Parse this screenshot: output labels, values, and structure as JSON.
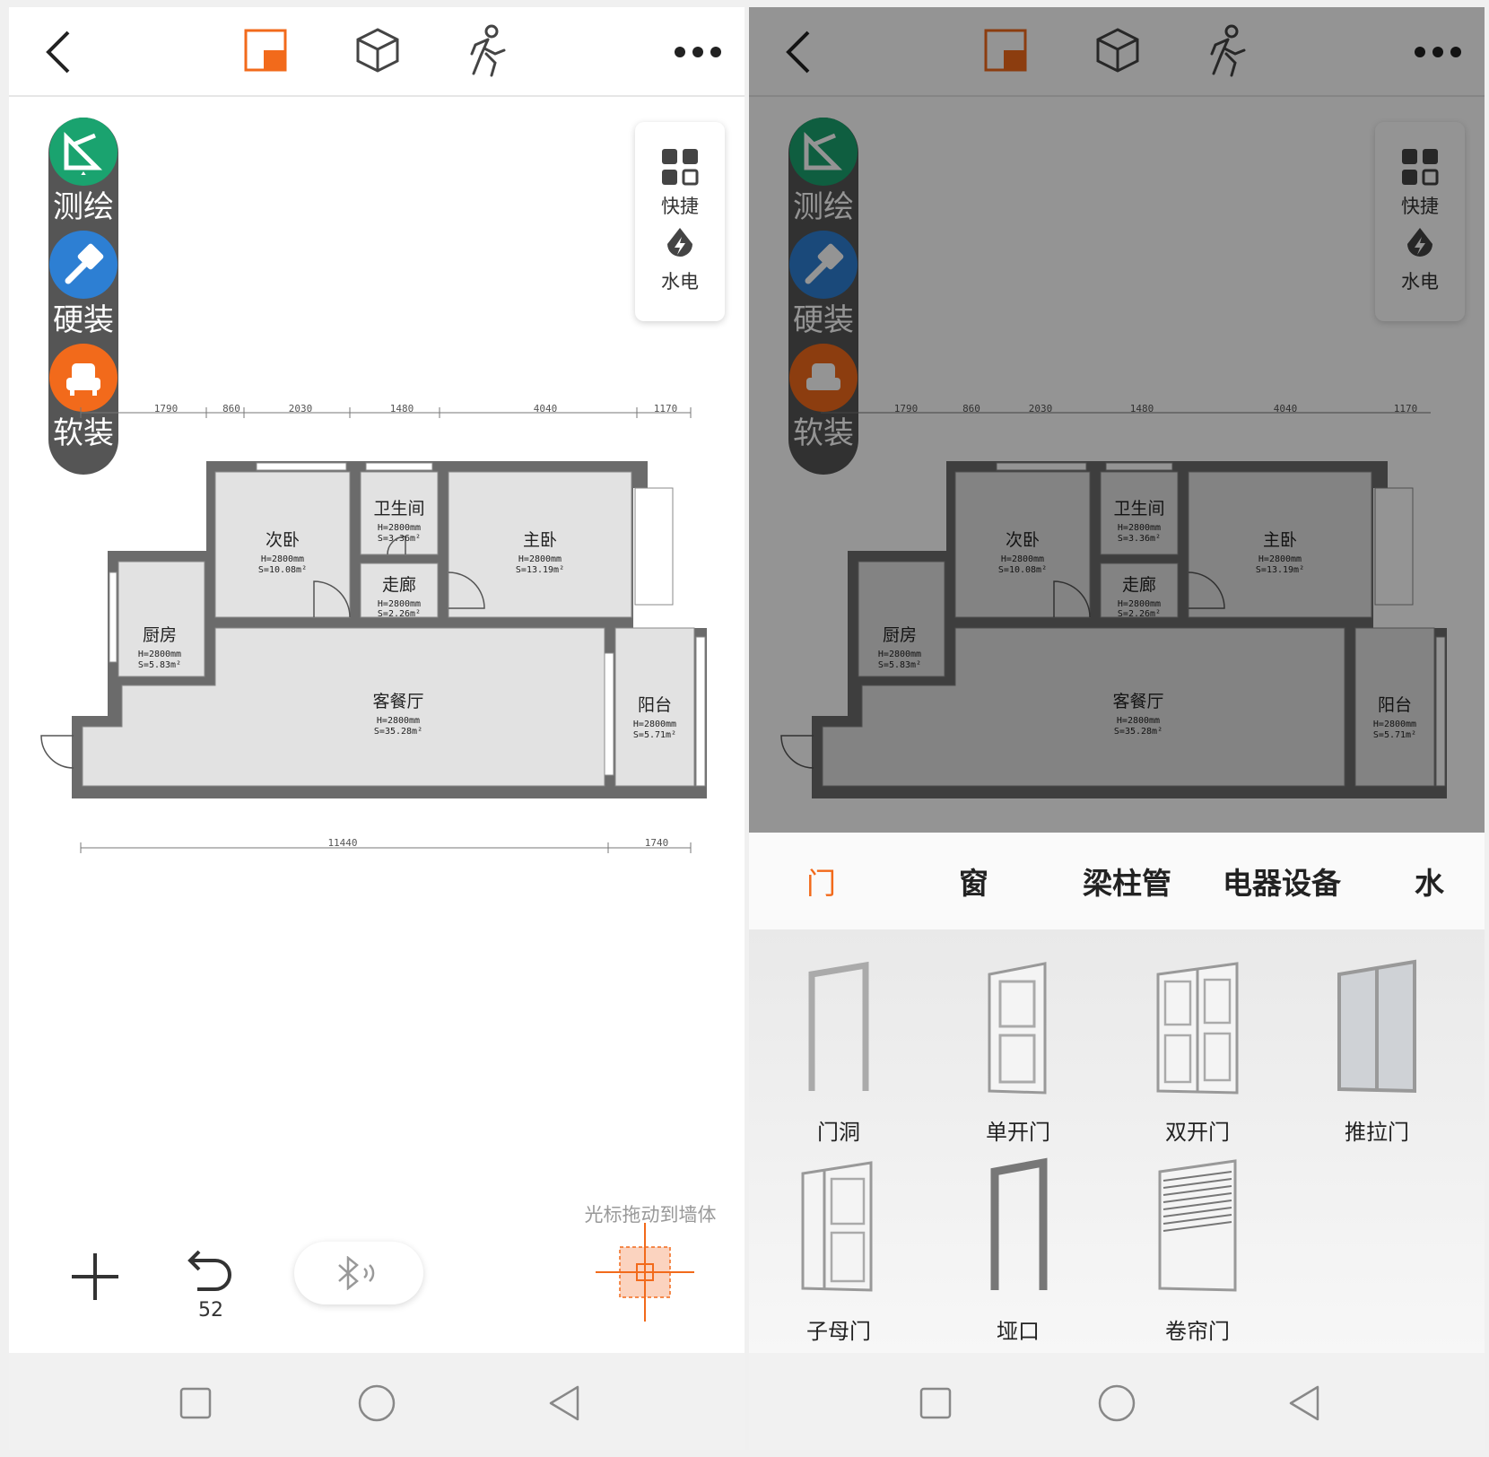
{
  "colors": {
    "accent": "#f26a1b",
    "survey": "#1aa36f",
    "hard": "#2d7fd3",
    "soft": "#f26a1b",
    "dark_bar": "#555555"
  },
  "left_screen": {
    "toolbar": {
      "back_icon": "chevron-left-icon",
      "plan_icon": "floor-plan-icon",
      "cube_icon": "3d-cube-icon",
      "walk_icon": "walk-icon",
      "more_icon": "more-icon"
    },
    "side_tools": [
      {
        "label": "测绘",
        "icon": "ruler-icon"
      },
      {
        "label": "硬装",
        "icon": "brush-icon"
      },
      {
        "label": "软装",
        "icon": "sofa-icon"
      }
    ],
    "quick_panel": {
      "shortcut_label": "快捷",
      "water_elec_label": "水电"
    },
    "floorplan": {
      "top_dims": [
        "1790",
        "860",
        "2030",
        "1480",
        "4040",
        "1170"
      ],
      "bottom_dims": [
        "11440",
        "1740"
      ],
      "rooms": [
        {
          "name": "次卧",
          "height": "H=2800mm",
          "area": "S=10.08m²"
        },
        {
          "name": "卫生间",
          "height": "H=2800mm",
          "area": "S=3.36m²"
        },
        {
          "name": "主卧",
          "height": "H=2800mm",
          "area": "S=13.19m²"
        },
        {
          "name": "走廊",
          "height": "H=2800mm",
          "area": "S=2.26m²"
        },
        {
          "name": "厨房",
          "height": "H=2800mm",
          "area": "S=5.83m²"
        },
        {
          "name": "客餐厅",
          "height": "H=2800mm",
          "area": "S=35.28m²"
        },
        {
          "name": "阳台",
          "height": "H=2800mm",
          "area": "S=5.71m²"
        }
      ]
    },
    "hint": "光标拖动到墙体",
    "undo_count": "52"
  },
  "right_screen": {
    "categories": [
      {
        "label": "门",
        "active": true
      },
      {
        "label": "窗",
        "active": false
      },
      {
        "label": "梁柱管",
        "active": false
      },
      {
        "label": "电器设备",
        "active": false
      },
      {
        "label": "水",
        "active": false
      }
    ],
    "items": [
      {
        "label": "门洞"
      },
      {
        "label": "单开门"
      },
      {
        "label": "双开门"
      },
      {
        "label": "推拉门"
      },
      {
        "label": "子母门"
      },
      {
        "label": "垭口"
      },
      {
        "label": "卷帘门"
      }
    ]
  }
}
